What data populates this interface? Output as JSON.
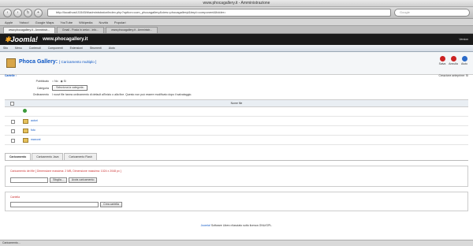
{
  "browser": {
    "window_title": "www.phocagallery.it - Amministrazione",
    "url": "http://localhost/J1545/it/administrator/index.php?option=com_phocagallery&view=phocagalleryi&tmpl=component&folder=",
    "search_placeholder": "Google",
    "bookmarks": [
      "Apple",
      "Yahoo!",
      "Google Maps",
      "YouTube",
      "Wikipedia",
      "Novità",
      "Popolari"
    ],
    "tabs": [
      "www.phocagallery.it - Amministr...",
      "Gmail - Posta in arrivo - info...",
      "www.phocagallery.it - Amministr..."
    ]
  },
  "joomla": {
    "logo": "Joomla!",
    "site": "www.phocagallery.it",
    "version": "Version",
    "menu": [
      "Sito",
      "Menu",
      "Contenuti",
      "Componenti",
      "Estensioni",
      "Strumenti",
      "Aiuto"
    ]
  },
  "page": {
    "title": "Phoca Gallery:",
    "subtitle": "[ Caricamento multiplo ]",
    "toolbar": [
      "Salva",
      "Annulla",
      "Aiuto"
    ],
    "crumbs": "Cartelle :",
    "right_info": "Creazione anteprime: Si",
    "form": {
      "published_label": "Pubblicato",
      "published_options": [
        "No",
        "Si"
      ],
      "category_label": "Categoria",
      "category_value": "- Seleziona la categoria -",
      "approved_label": "Ordinamento",
      "approved_value": "I nuovi file hanno ordinamento di default all'inizio o alla fine. Questo non può essere modificato dopo il salvataggio."
    },
    "list": {
      "header_name": "Nome file",
      "items": [
        {
          "type": "up",
          "name": ""
        },
        {
          "type": "folder",
          "name": "autori"
        },
        {
          "type": "folder",
          "name": "foto"
        },
        {
          "type": "folder",
          "name": "marconi"
        }
      ]
    },
    "bottom_tabs": [
      "Caricamento",
      "Caricamento Java",
      "Caricamento Flash"
    ],
    "upload": {
      "legend": "Caricamento dei file [ Dimensione massima: 2 MB, Dimensione massima: 1024 x 2048 px ]",
      "browse_label": "Sfoglia...",
      "start_label": "Avvia caricamento"
    },
    "folder": {
      "legend": "Cartella",
      "create_label": "Crea cartella"
    }
  },
  "footer": {
    "link": "Joomla!",
    "text": "Software Libero rilasciato sotto licenza GNU/GPL."
  },
  "status": "Caricamento..."
}
